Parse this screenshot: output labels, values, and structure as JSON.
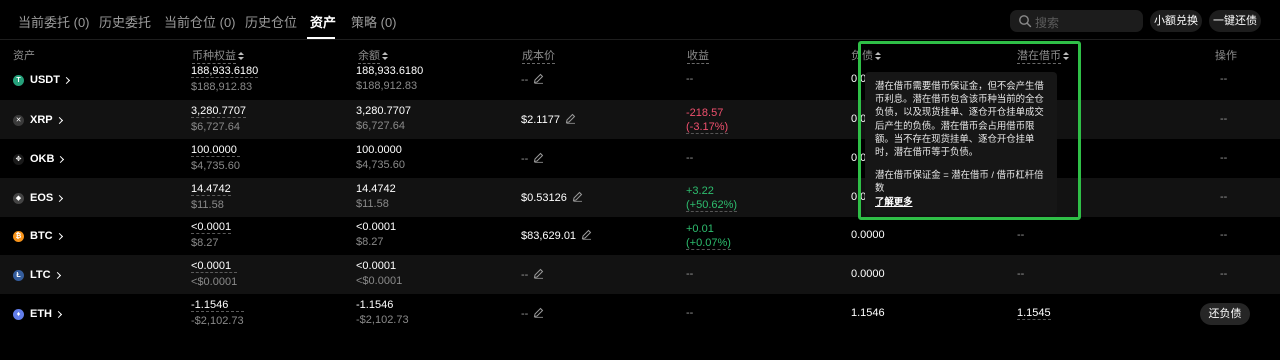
{
  "tabs": [
    {
      "label": "当前委托 (0)",
      "active": false
    },
    {
      "label": "历史委托",
      "active": false
    },
    {
      "label": "当前仓位 (0)",
      "active": false
    },
    {
      "label": "历史仓位",
      "active": false
    },
    {
      "label": "资产",
      "active": true
    },
    {
      "label": "策略 (0)",
      "active": false
    }
  ],
  "search": {
    "placeholder": "搜索",
    "icon": "search-icon"
  },
  "actions": {
    "small_convert": "小额兑换",
    "repay_all": "一键还债"
  },
  "columns": {
    "asset": "资产",
    "coin_equity": "币种权益",
    "balance": "余额",
    "cost_price": "成本价",
    "pnl": "收益",
    "liability": "负债",
    "potential_borrow": "潜在借币",
    "operation": "操作"
  },
  "rows": [
    {
      "symbol": "USDT",
      "coin_color": "#26a17b",
      "coin_glyph": "T",
      "equity": "188,933.6180",
      "equity_usd": "$188,912.83",
      "balance": "188,933.6180",
      "balance_usd": "$188,912.83",
      "cost": "--",
      "pnl": "--",
      "pnl_pct": "",
      "liability": "0.0",
      "potential": "",
      "op": "--"
    },
    {
      "symbol": "XRP",
      "coin_color": "#3a3a3a",
      "coin_glyph": "✕",
      "equity": "3,280.7707",
      "equity_usd": "$6,727.64",
      "balance": "3,280.7707",
      "balance_usd": "$6,727.64",
      "cost": "$2.1177",
      "pnl": "-218.57",
      "pnl_pct": "(-3.17%)",
      "liability": "0.0",
      "potential": "",
      "op": "--"
    },
    {
      "symbol": "OKB",
      "coin_color": "#1a1a1a",
      "coin_glyph": "✥",
      "equity": "100.0000",
      "equity_usd": "$4,735.60",
      "balance": "100.0000",
      "balance_usd": "$4,735.60",
      "cost": "--",
      "pnl": "--",
      "pnl_pct": "",
      "liability": "0.0",
      "potential": "",
      "op": "--"
    },
    {
      "symbol": "EOS",
      "coin_color": "#444444",
      "coin_glyph": "◆",
      "equity": "14.4742",
      "equity_usd": "$11.58",
      "balance": "14.4742",
      "balance_usd": "$11.58",
      "cost": "$0.53126",
      "pnl": "+3.22",
      "pnl_pct": "(+50.62%)",
      "liability": "0.0",
      "potential": "",
      "op": "--"
    },
    {
      "symbol": "BTC",
      "coin_color": "#f7931a",
      "coin_glyph": "₿",
      "equity": "<0.0001",
      "equity_usd": "$8.27",
      "balance": "<0.0001",
      "balance_usd": "$8.27",
      "cost": "$83,629.01",
      "pnl": "+0.01",
      "pnl_pct": "(+0.07%)",
      "liability": "0.0000",
      "potential": "--",
      "op": "--"
    },
    {
      "symbol": "LTC",
      "coin_color": "#345d9d",
      "coin_glyph": "Ł",
      "equity": "<0.0001",
      "equity_usd": "<$0.0001",
      "balance": "<0.0001",
      "balance_usd": "<$0.0001",
      "cost": "--",
      "pnl": "--",
      "pnl_pct": "",
      "liability": "0.0000",
      "potential": "--",
      "op": "--"
    },
    {
      "symbol": "ETH",
      "coin_color": "#627eea",
      "coin_glyph": "♦",
      "equity": "-1.1546",
      "equity_usd": "-$2,102.73",
      "balance": "-1.1546",
      "balance_usd": "-$2,102.73",
      "cost": "--",
      "pnl": "--",
      "pnl_pct": "",
      "liability": "1.1546",
      "potential": "1.1545",
      "op": "还负债"
    }
  ],
  "tooltip": {
    "body": "潜在借币需要借币保证金，但不会产生借币利息。潜在借币包含该币种当前的全仓负债，以及现货挂单、逐仓开仓挂单成交后产生的负债。潜在借币会占用借币限额。当不存在现货挂单、逐仓开仓挂单时，潜在借币等于负债。",
    "formula": "潜在借币保证金 = 潜在借币 / 借币杠杆倍数",
    "learn_more": "了解更多"
  },
  "colors": {
    "highlight": "#2fbf47",
    "negative": "#f0506e",
    "positive": "#2dbd6e"
  }
}
